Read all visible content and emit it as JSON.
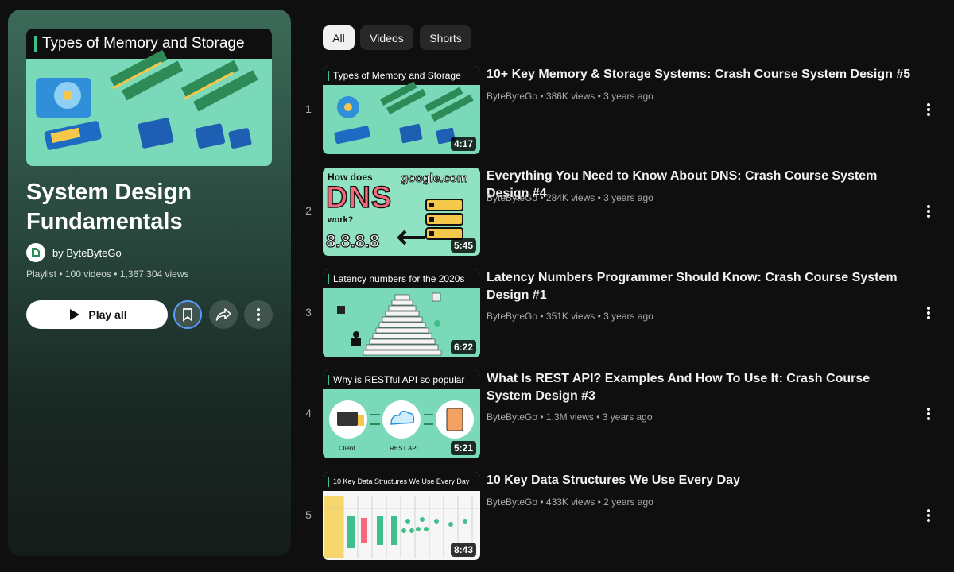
{
  "colors": {
    "accent_green": "#3fbf8a",
    "thumb_mint": "#79d9b8",
    "focus_blue": "#5a9bff"
  },
  "playlist": {
    "cover_title": "Types of Memory and Storage",
    "title": "System Design Fundamentals",
    "owner": "by ByteByteGo",
    "meta": "Playlist • 100 videos • 1,367,304 views",
    "play_all_label": "Play all",
    "icons": {
      "save": "bookmark-icon",
      "share": "share-icon",
      "more": "more-vert-icon",
      "play": "play-icon"
    }
  },
  "chips": [
    {
      "label": "All",
      "active": true
    },
    {
      "label": "Videos",
      "active": false
    },
    {
      "label": "Shorts",
      "active": false
    }
  ],
  "videos": [
    {
      "index": "1",
      "thumb_text": "Types of Memory and Storage",
      "duration": "4:17",
      "title": "10+ Key Memory & Storage Systems: Crash Course System Design #5",
      "meta": "ByteByteGo • 386K views • 3 years ago"
    },
    {
      "index": "2",
      "thumb_text": "",
      "thumb_dns_top": "How does",
      "thumb_dns_big": "DNS",
      "thumb_dns_work": "work?",
      "thumb_dns_domain": "google.com",
      "thumb_dns_ip": "8.8.8.8",
      "duration": "5:45",
      "title": "Everything You Need to Know About DNS: Crash Course System Design #4",
      "meta": "ByteByteGo • 284K views • 3 years ago"
    },
    {
      "index": "3",
      "thumb_text": "Latency numbers for the 2020s",
      "duration": "6:22",
      "title": "Latency Numbers Programmer Should Know: Crash Course System Design #1",
      "meta": "ByteByteGo • 351K views • 3 years ago"
    },
    {
      "index": "4",
      "thumb_text": "Why is RESTful API so popular",
      "thumb_client": "Client",
      "thumb_restapi": "REST API",
      "duration": "5:21",
      "title": "What Is REST API? Examples And How To Use It: Crash Course System Design #3",
      "meta": "ByteByteGo • 1.3M views • 3 years ago"
    },
    {
      "index": "5",
      "thumb_text": "10 Key Data Structures We Use Every Day",
      "duration": "8:43",
      "title": "10 Key Data Structures We Use Every Day",
      "meta": "ByteByteGo • 433K views • 2 years ago"
    }
  ]
}
